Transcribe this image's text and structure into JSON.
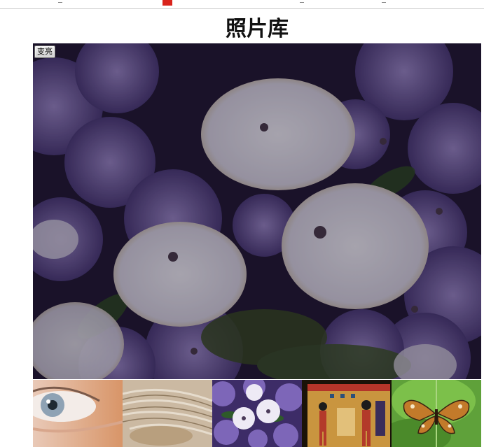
{
  "page": {
    "title": "照片库"
  },
  "viewer": {
    "toggle_label": "变亮",
    "current_image": "flowers-purple-white"
  },
  "thumbnails": [
    {
      "name": "eye"
    },
    {
      "name": "shell"
    },
    {
      "name": "flowers"
    },
    {
      "name": "egyptian-mural"
    },
    {
      "name": "butterfly"
    }
  ],
  "colors": {
    "dim_overlay": "#000000",
    "page_bg": "#ffffff",
    "title_text": "#111111"
  }
}
